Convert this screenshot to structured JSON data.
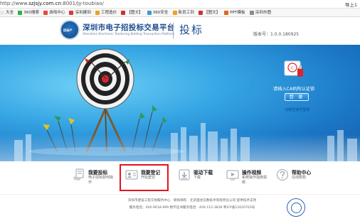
{
  "browser": {
    "url_prefix": "http://www.",
    "url_host": "szjsjy.com.cn",
    "url_rest": ":8001/jy-toubiao/",
    "right_util": "导上1",
    "bookmarks": [
      {
        "label": "大全",
        "color": "#e8e8e8",
        "icon": "folder-icon"
      },
      {
        "label": "360搜索",
        "color": "#29b34a",
        "icon": "360-search-icon"
      },
      {
        "label": "游戏中心",
        "color": "#e84a3c",
        "icon": "game-icon"
      },
      {
        "label": "深圳建到",
        "color": "#d23b3b",
        "icon": "building-icon"
      },
      {
        "label": "工程造价",
        "color": "#f0a020",
        "icon": "doc-icon"
      },
      {
        "label": "【图文】",
        "color": "#cc3333",
        "icon": "doc-icon"
      },
      {
        "label": "360安全",
        "color": "#3a9ad9",
        "icon": "shield-icon"
      },
      {
        "label": "新员工到",
        "color": "#f0a020",
        "icon": "doc-icon"
      },
      {
        "label": "【图文】",
        "color": "#cc3333",
        "icon": "doc-icon"
      },
      {
        "label": "PPT模板",
        "color": "#e0671b",
        "icon": "ppt-icon"
      },
      {
        "label": "深圳市图",
        "color": "#8a8a8a",
        "icon": "doc-icon"
      }
    ]
  },
  "header": {
    "logo_text": "招标产",
    "title": "深圳市电子招投标交易平台",
    "subtitle": "Shenzhen Electronic Tendering Bidding Transaction Platform",
    "section": "投标",
    "version": "版本号：1.0.0.180925"
  },
  "hero": {
    "ca_prompt": "请插入CA机构认证锁",
    "login_label": "登 录",
    "switch_label": "切换至账号登录"
  },
  "quick_entries": [
    {
      "title": "我要投标",
      "sub": "电子招标如何操作",
      "icon": "hand-doc-icon"
    },
    {
      "title": "我要登记",
      "sub": "开始登记",
      "icon": "register-card-icon"
    },
    {
      "title": "驱动下载",
      "sub": "下载",
      "icon": "download-icon"
    },
    {
      "title": "操作视频",
      "sub": "系统操作指南视频",
      "icon": "video-icon"
    },
    {
      "title": "帮助中心",
      "sub": "在线帮助",
      "icon": "help-icon"
    }
  ],
  "footer": {
    "line1": "深圳市建设工程交易服务中心 · 新烨纲有　北京国龙信数技术有限责任公司 提供技术支持",
    "line2": "服务电话：400-9618-999 数字证书服务电话：400-112-3838 粤ICP备12020763号"
  },
  "colors": {
    "title_blue": "#1c4c8c",
    "highlight_red": "#e0141b",
    "hero_blue": "#1b78c7"
  }
}
